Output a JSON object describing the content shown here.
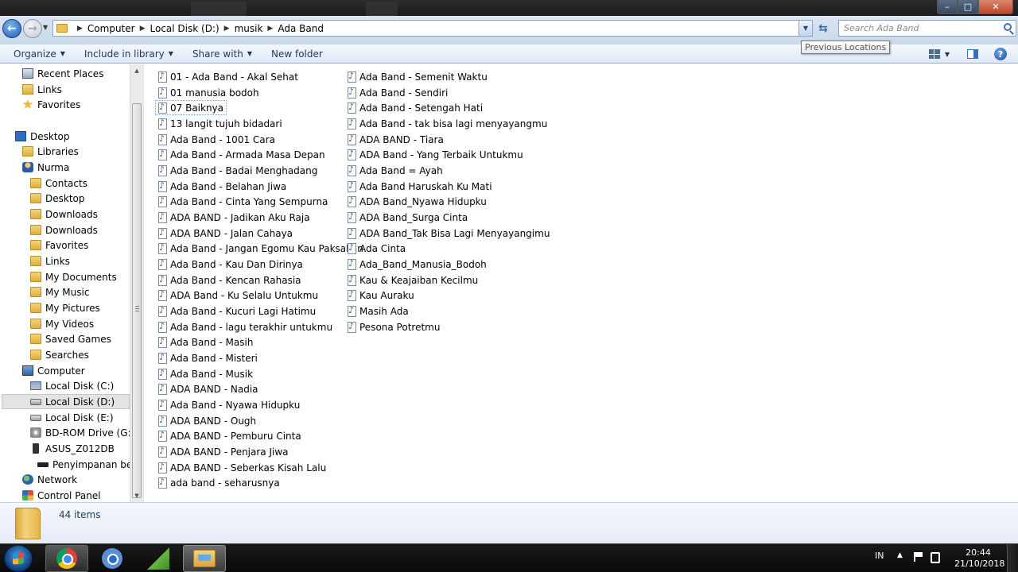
{
  "window": {
    "minimize": "–",
    "maximize": "□",
    "close": "✕"
  },
  "address": {
    "crumbs": [
      "Computer",
      "Local Disk (D:)",
      "musik",
      "Ada Band"
    ],
    "search_placeholder": "Search Ada Band",
    "tooltip": "Previous Locations"
  },
  "toolbar": {
    "organize": "Organize",
    "include_in_library": "Include in library",
    "share_with": "Share with",
    "new_folder": "New folder",
    "help": "?"
  },
  "navigation": {
    "items": [
      {
        "label": "Recent Places",
        "icon": "recent-places-icon"
      },
      {
        "label": "Links",
        "icon": "links-folder-icon"
      },
      {
        "label": "Favorites",
        "icon": "favorites-icon"
      },
      {
        "label": "Desktop",
        "icon": "desktop-icon"
      },
      {
        "label": "Libraries",
        "icon": "libraries-icon"
      },
      {
        "label": "Nurma",
        "icon": "user-icon"
      },
      {
        "label": "Contacts",
        "icon": "folder-icon"
      },
      {
        "label": "Desktop",
        "icon": "folder-icon"
      },
      {
        "label": "Downloads",
        "icon": "folder-icon"
      },
      {
        "label": "Downloads",
        "icon": "folder-icon"
      },
      {
        "label": "Favorites",
        "icon": "folder-icon"
      },
      {
        "label": "Links",
        "icon": "folder-icon"
      },
      {
        "label": "My Documents",
        "icon": "folder-icon"
      },
      {
        "label": "My Music",
        "icon": "folder-icon"
      },
      {
        "label": "My Pictures",
        "icon": "folder-icon"
      },
      {
        "label": "My Videos",
        "icon": "folder-icon"
      },
      {
        "label": "Saved Games",
        "icon": "folder-icon"
      },
      {
        "label": "Searches",
        "icon": "folder-icon"
      },
      {
        "label": "Computer",
        "icon": "computer-icon"
      },
      {
        "label": "Local Disk (C:)",
        "icon": "system-drive-icon"
      },
      {
        "label": "Local Disk (D:)",
        "icon": "drive-icon"
      },
      {
        "label": "Local Disk (E:)",
        "icon": "drive-icon"
      },
      {
        "label": "BD-ROM Drive (G:)",
        "icon": "dvd-drive-icon"
      },
      {
        "label": "ASUS_Z012DB",
        "icon": "phone-icon"
      },
      {
        "label": "Penyimpanan bersa",
        "icon": "storage-icon"
      },
      {
        "label": "Network",
        "icon": "network-icon"
      },
      {
        "label": "Control Panel",
        "icon": "control-panel-icon"
      }
    ]
  },
  "files": {
    "column1": [
      "01 - Ada Band - Akal Sehat",
      "01 manusia bodoh",
      "07 Baiknya",
      "13 langit tujuh bidadari",
      "Ada Band - 1001 Cara",
      "Ada Band - Armada Masa Depan",
      "Ada Band - Badai Menghadang",
      "Ada Band - Belahan Jiwa",
      "Ada Band - Cinta Yang Sempurna",
      "ADA BAND - Jadikan Aku Raja",
      "ADA BAND - Jalan Cahaya",
      "Ada Band - Jangan Egomu Kau Paksakan",
      "Ada Band - Kau Dan Dirinya",
      "Ada Band - Kencan Rahasia",
      "ADA Band - Ku Selalu Untukmu",
      "Ada Band - Kucuri Lagi Hatimu",
      "Ada Band - lagu terakhir untukmu",
      "Ada Band - Masih",
      "Ada Band - Misteri",
      "Ada Band - Musik",
      "ADA BAND - Nadia",
      "Ada Band - Nyawa Hidupku",
      "ADA BAND - Ough",
      "ADA BAND - Pemburu Cinta",
      "ADA BAND - Penjara Jiwa",
      "ADA BAND - Seberkas Kisah Lalu",
      "ada band - seharusnya"
    ],
    "column2": [
      "Ada Band - Semenit Waktu",
      "Ada Band - Sendiri",
      "Ada Band - Setengah Hati",
      "Ada Band - tak bisa lagi menyayangmu",
      "ADA BAND - Tiara",
      "ADA Band - Yang Terbaik Untukmu",
      "Ada Band = Ayah",
      "Ada Band Haruskah Ku Mati",
      "ADA Band_Nyawa Hidupku",
      "ADA Band_Surga Cinta",
      "ADA Band_Tak Bisa Lagi Menyayangimu",
      "Ada Cinta",
      "Ada_Band_Manusia_Bodoh",
      "Kau & Keajaiban Kecilmu",
      "Kau Auraku",
      "Masih Ada",
      "Pesona Potretmu"
    ]
  },
  "details": {
    "count": "44 items"
  },
  "taskbar": {
    "language": "IN",
    "time": "20:44",
    "date": "21/10/2018"
  }
}
